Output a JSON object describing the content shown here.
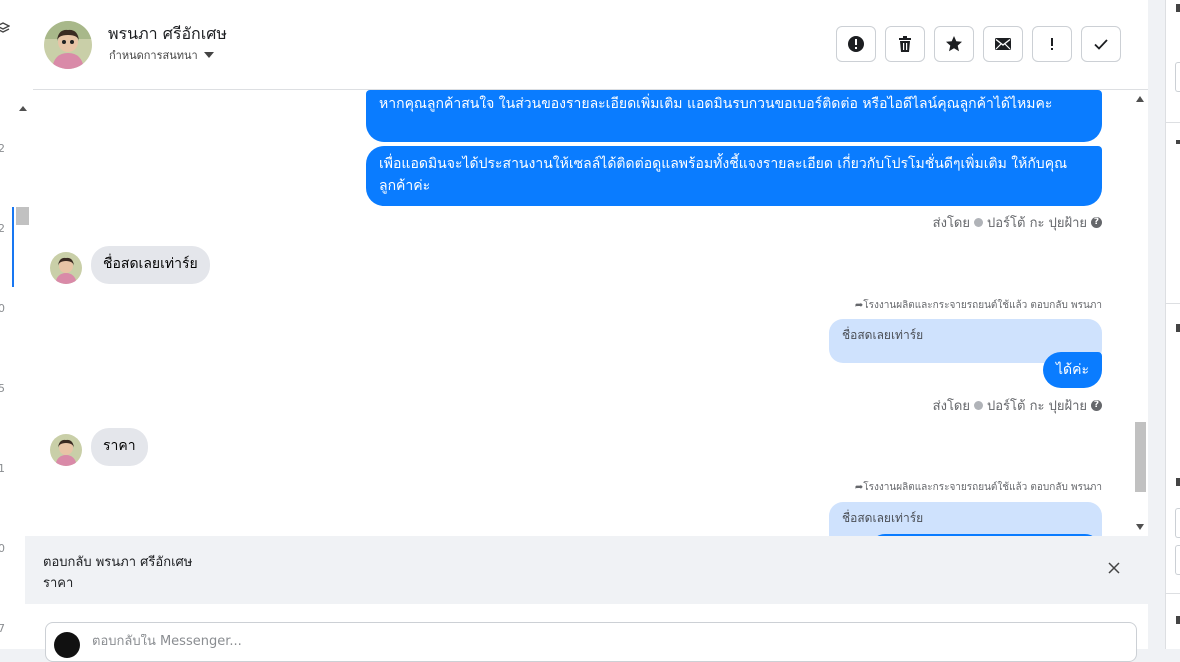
{
  "left_strip": {
    "numbers": [
      "2",
      "2",
      "0",
      "5",
      "1",
      "0",
      "7"
    ]
  },
  "header": {
    "contact_name": "พรนภา ศรีอักเศษ",
    "assign_label": "กำหนดการสนทนา",
    "toolbar": [
      {
        "name": "spam-button",
        "icon": "alert-circle-icon"
      },
      {
        "name": "delete-button",
        "icon": "trash-icon"
      },
      {
        "name": "star-button",
        "icon": "star-icon"
      },
      {
        "name": "mark-unread-button",
        "icon": "envelope-icon"
      },
      {
        "name": "follow-up-button",
        "icon": "exclamation-icon"
      },
      {
        "name": "mark-done-button",
        "icon": "check-icon"
      }
    ]
  },
  "thread": {
    "messages": [
      {
        "direction": "out",
        "text": "หากคุณลูกค้าสนใจ ในส่วนของรายละเอียดเพิ่มเติม แอดมินรบกวนขอเบอร์ติดต่อ หรือไอดีไลน์คุณลูกค้าได้ไหมคะ"
      },
      {
        "direction": "out",
        "text": "เพื่อแอดมินจะได้ประสานงานให้เซลล์ได้ติดต่อดูแลพร้อมทั้งชี้แจงรายละเอียด เกี่ยวกับโปรโมชั่นดีๆเพิ่มเติม ให้กับคุณลูกค้าค่ะ"
      },
      {
        "direction": "meta",
        "sent_by_prefix": "ส่งโดย",
        "sender": "ปอร์โต้ กะ ปุยฝ้าย"
      },
      {
        "direction": "in",
        "text": "ชื่อสดเลยเท่าร์ย"
      },
      {
        "direction": "reply-note",
        "text": "โรงงานผลิตและกระจายรถยนต์ใช้แล้ว ตอบกลับ พรนภา"
      },
      {
        "direction": "quoted",
        "text": "ชื่อสดเลยเท่าร์ย"
      },
      {
        "direction": "out",
        "text": "ได้ค่ะ"
      },
      {
        "direction": "meta",
        "sent_by_prefix": "ส่งโดย",
        "sender": "ปอร์โต้ กะ ปุยฝ้าย"
      },
      {
        "direction": "in",
        "text": "ราคา"
      },
      {
        "direction": "reply-note",
        "text": "โรงงานผลิตและกระจายรถยนต์ใช้แล้ว ตอบกลับ พรนภา"
      },
      {
        "direction": "quoted",
        "text": "ชื่อสดเลยเท่าร์ย"
      }
    ]
  },
  "reply_panel": {
    "title": "ตอบกลับ พรนภา ศรีอักเศษ",
    "quoted_text": "ราคา"
  },
  "composer": {
    "placeholder": "ตอบกลับใน Messenger...",
    "value": ""
  },
  "colors": {
    "outgoing_bubble": "#0a7cff",
    "incoming_bubble": "#e4e6eb",
    "quoted_bubble": "#cfe2fd",
    "accent": "#1877f2"
  }
}
